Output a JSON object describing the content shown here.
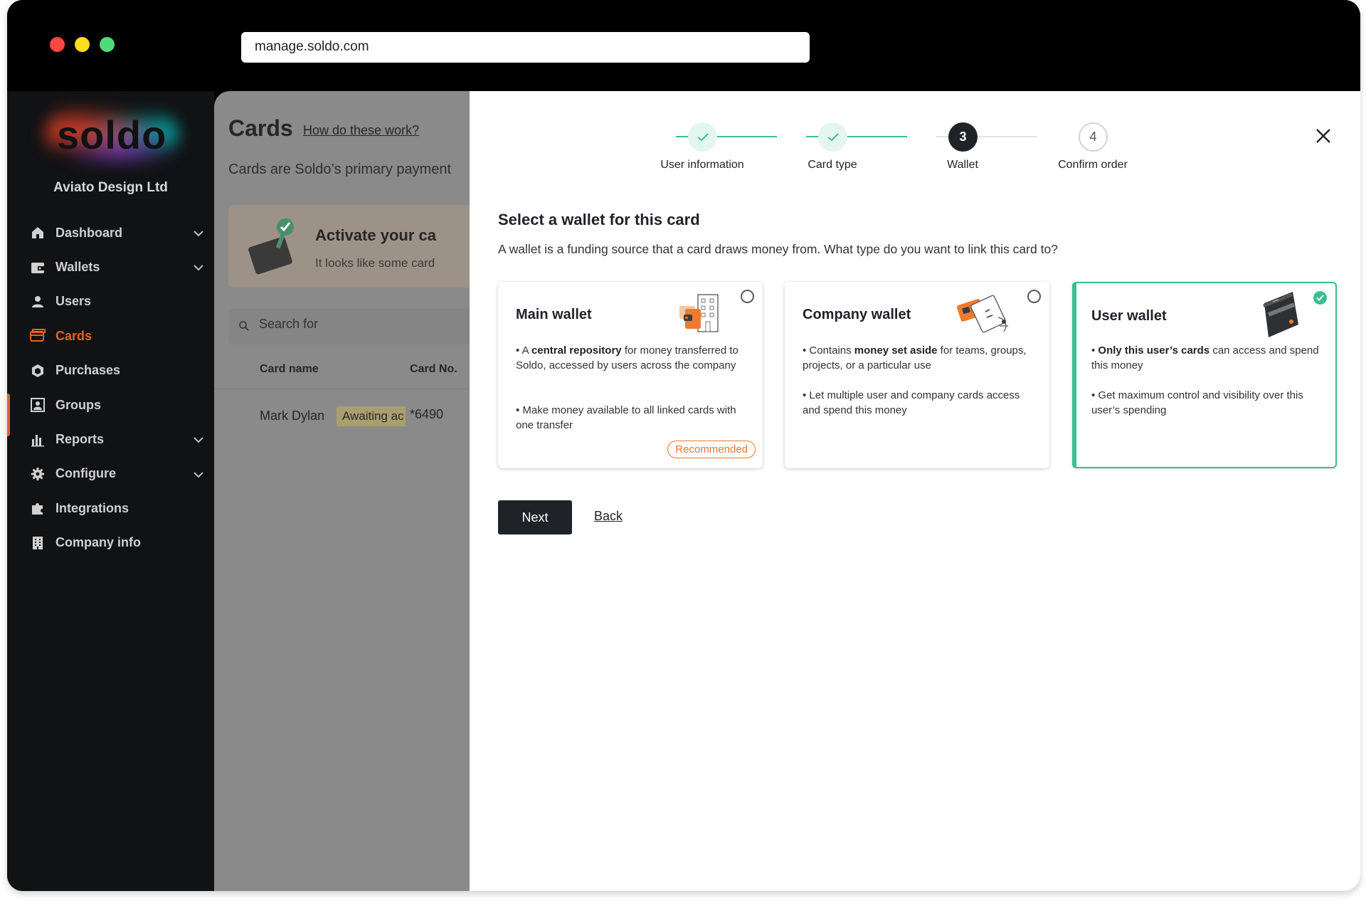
{
  "browser": {
    "url": "manage.soldo.com"
  },
  "sidebar": {
    "logo": "soldo",
    "company": "Aviato Design Ltd",
    "items": [
      {
        "label": "Dashboard",
        "icon": "home-icon",
        "chevron": true,
        "active": false
      },
      {
        "label": "Wallets",
        "icon": "wallet-icon",
        "chevron": true,
        "active": false
      },
      {
        "label": "Users",
        "icon": "user-icon",
        "chevron": false,
        "active": false
      },
      {
        "label": "Cards",
        "icon": "card-icon",
        "chevron": false,
        "active": true
      },
      {
        "label": "Purchases",
        "icon": "purchases-icon",
        "chevron": false,
        "active": false
      },
      {
        "label": "Groups",
        "icon": "groups-icon",
        "chevron": false,
        "active": false
      },
      {
        "label": "Reports",
        "icon": "reports-icon",
        "chevron": true,
        "active": false
      },
      {
        "label": "Configure",
        "icon": "gear-icon",
        "chevron": true,
        "active": false
      },
      {
        "label": "Integrations",
        "icon": "puzzle-icon",
        "chevron": false,
        "active": false
      },
      {
        "label": "Company info",
        "icon": "building-icon",
        "chevron": false,
        "active": false
      }
    ]
  },
  "background_page": {
    "title": "Cards",
    "help_link": "How do these work?",
    "subtitle": "Cards are Soldo’s primary payment",
    "banner_title": "Activate your ca",
    "banner_text": "It looks like some card",
    "search_placeholder": "Search for",
    "columns": [
      "Card name",
      "Card No."
    ],
    "row": {
      "name": "Mark Dylan",
      "status": "Awaiting ac",
      "card_no": "*6490"
    }
  },
  "modal": {
    "steps": [
      {
        "label": "User information",
        "state": "done",
        "number": "1"
      },
      {
        "label": "Card type",
        "state": "done",
        "number": "2"
      },
      {
        "label": "Wallet",
        "state": "current",
        "number": "3"
      },
      {
        "label": "Confirm order",
        "state": "todo",
        "number": "4"
      }
    ],
    "heading": "Select a wallet for this card",
    "description": "A wallet is a funding source that a card draws money from. What type do you want to link this card to?",
    "cards": [
      {
        "title": "Main wallet",
        "selected": false,
        "badge": "Recommended",
        "bullets": [
          [
            "• A ",
            "central repository",
            " for money transferred to Soldo, accessed by users across the company"
          ],
          [
            "• Make money available to all linked cards with one transfer",
            "",
            ""
          ]
        ]
      },
      {
        "title": "Company wallet",
        "selected": false,
        "badge": "",
        "bullets": [
          [
            "• Contains ",
            "money set aside",
            " for teams, groups, projects, or a particular use"
          ],
          [
            "• Let multiple user and company cards access and spend this money",
            "",
            ""
          ]
        ]
      },
      {
        "title": "User wallet",
        "selected": true,
        "badge": "",
        "bullets": [
          [
            "• ",
            "Only this user’s cards",
            " can access and spend this money"
          ],
          [
            "• Get maximum control and visibility over this user’s spending",
            "",
            ""
          ]
        ]
      }
    ],
    "next_label": "Next",
    "back_label": "Back"
  },
  "colors": {
    "accent_green": "#3cbe93",
    "accent_orange": "#e2622a",
    "dark": "#1f2327"
  }
}
